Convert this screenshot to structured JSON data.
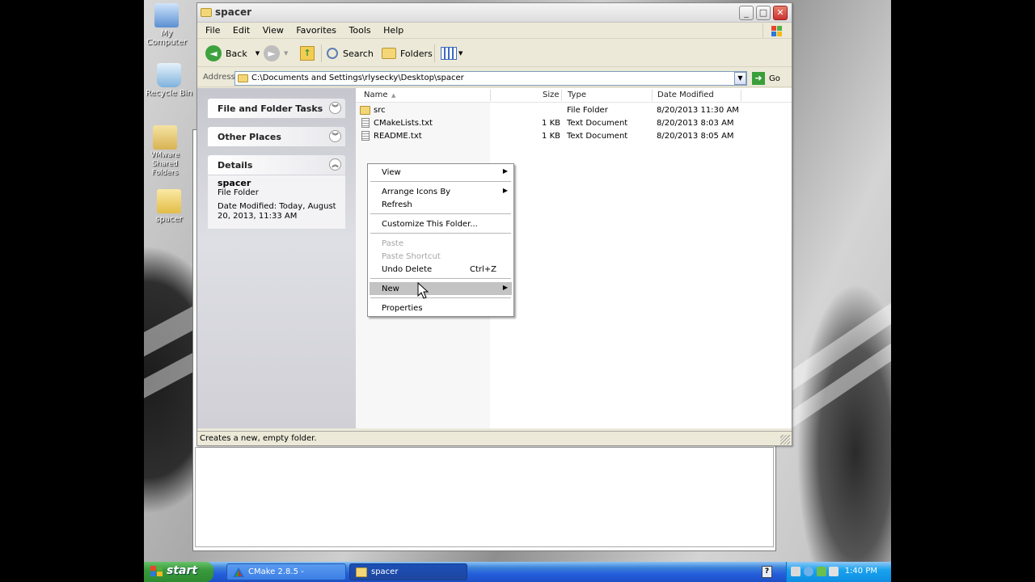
{
  "desktop": {
    "icons": [
      {
        "label": "My Computer"
      },
      {
        "label": "Recycle Bin"
      },
      {
        "label": "VMware Shared Folders"
      },
      {
        "label": "spacer"
      }
    ]
  },
  "window": {
    "title": "spacer",
    "menu": [
      "File",
      "Edit",
      "View",
      "Favorites",
      "Tools",
      "Help"
    ],
    "toolbar": {
      "back_label": "Back",
      "search_label": "Search",
      "folders_label": "Folders"
    },
    "address": {
      "label": "Address",
      "path": "C:\\Documents and Settings\\rlysecky\\Desktop\\spacer",
      "go_label": "Go"
    },
    "task_panes": {
      "file_folder_tasks": "File and Folder Tasks",
      "other_places": "Other Places",
      "details": "Details",
      "details_name": "spacer",
      "details_type": "File Folder",
      "details_modified": "Date Modified: Today, August 20, 2013, 11:33 AM"
    },
    "columns": {
      "name": "Name",
      "size": "Size",
      "type": "Type",
      "modified": "Date Modified"
    },
    "files": [
      {
        "name": "src",
        "size": "",
        "type": "File Folder",
        "modified": "8/20/2013 11:30 AM",
        "icon": "folder-icon"
      },
      {
        "name": "CMakeLists.txt",
        "size": "1 KB",
        "type": "Text Document",
        "modified": "8/20/2013 8:03 AM",
        "icon": "text-document-icon"
      },
      {
        "name": "README.txt",
        "size": "1 KB",
        "type": "Text Document",
        "modified": "8/20/2013 8:05 AM",
        "icon": "text-document-icon"
      }
    ],
    "status_text": "Creates a new, empty folder."
  },
  "context_menu": {
    "view": "View",
    "arrange": "Arrange Icons By",
    "refresh": "Refresh",
    "customize": "Customize This Folder...",
    "paste": "Paste",
    "paste_shortcut": "Paste Shortcut",
    "undo_delete": "Undo Delete",
    "undo_shortcut": "Ctrl+Z",
    "new": "New",
    "properties": "Properties"
  },
  "taskbar": {
    "start_label": "start",
    "tasks": [
      {
        "label": "CMake 2.8.5 -"
      },
      {
        "label": "spacer"
      }
    ],
    "clock": "1:40 PM"
  },
  "colors": {
    "taskbar_blue": "#245edb",
    "start_green": "#3b9a3d",
    "menu_highlight": "#c3c3c3",
    "close_red": "#c33"
  }
}
